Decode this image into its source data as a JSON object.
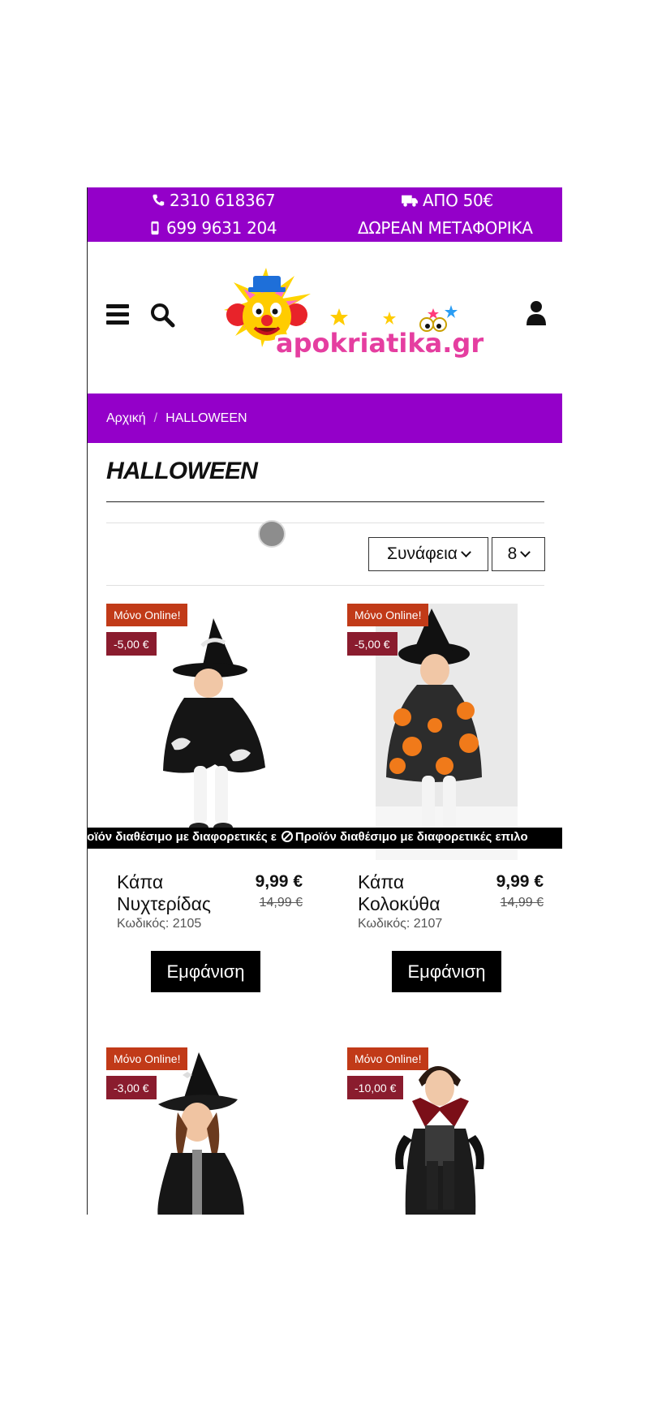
{
  "topbar": {
    "phone1": "2310 618367",
    "phone2": "699 9631 204",
    "shipping_line1": "ΑΠΟ 50€",
    "shipping_line2": "ΔΩΡΕΑΝ ΜΕΤΑΦΟΡΙΚΑ",
    "background": "#9400c9"
  },
  "header": {
    "logo_text": "apokriatika.gr"
  },
  "breadcrumb": {
    "home": "Αρχική",
    "separator": "/",
    "current": "HALLOWEEN"
  },
  "page": {
    "title": "HALLOWEEN"
  },
  "sort": {
    "selected": "Συνάφεια",
    "per_page": "8"
  },
  "ticker": {
    "text": "Προϊόν διαθέσιμο με διαφορετικές επιλογές",
    "left_fragment": "ροϊόν διαθέσιμο με διαφορετικές ε",
    "right_fragment": "Προϊόν διαθέσιμο με διαφορετικές επιλο"
  },
  "products": [
    {
      "badge_online": "Μόνο Online!",
      "badge_discount": "-5,00 €",
      "name": "Κάπα Νυχτερίδας",
      "price": "9,99 €",
      "old_price": "14,99 €",
      "code": "Κωδικός: 2105",
      "button": "Εμφάνιση"
    },
    {
      "badge_online": "Μόνο Online!",
      "badge_discount": "-5,00 €",
      "name": "Κάπα Κολοκύθα",
      "price": "9,99 €",
      "old_price": "14,99 €",
      "code": "Κωδικός: 2107",
      "button": "Εμφάνιση"
    },
    {
      "badge_online": "Μόνο Online!",
      "badge_discount": "-3,00 €"
    },
    {
      "badge_online": "Μόνο Online!",
      "badge_discount": "-10,00 €"
    }
  ]
}
